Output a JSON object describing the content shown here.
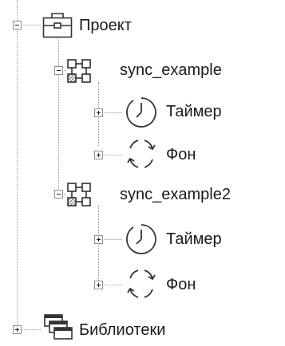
{
  "tree": {
    "project": {
      "label": "Проект",
      "icon": "briefcase-icon",
      "expanded": true
    },
    "program1": {
      "label": "sync_example",
      "icon": "program-blocks-icon",
      "expanded": true,
      "children": [
        {
          "label": "Таймер",
          "icon": "timer-icon",
          "expanded": false
        },
        {
          "label": "Фон",
          "icon": "cycle-icon",
          "expanded": false
        }
      ]
    },
    "program2": {
      "label": "sync_example2",
      "icon": "program-blocks-icon",
      "expanded": true,
      "children": [
        {
          "label": "Таймер",
          "icon": "timer-icon",
          "expanded": false
        },
        {
          "label": "Фон",
          "icon": "cycle-icon",
          "expanded": false
        }
      ]
    },
    "libraries": {
      "label": "Библиотеки",
      "icon": "libraries-icon",
      "expanded": false
    }
  }
}
